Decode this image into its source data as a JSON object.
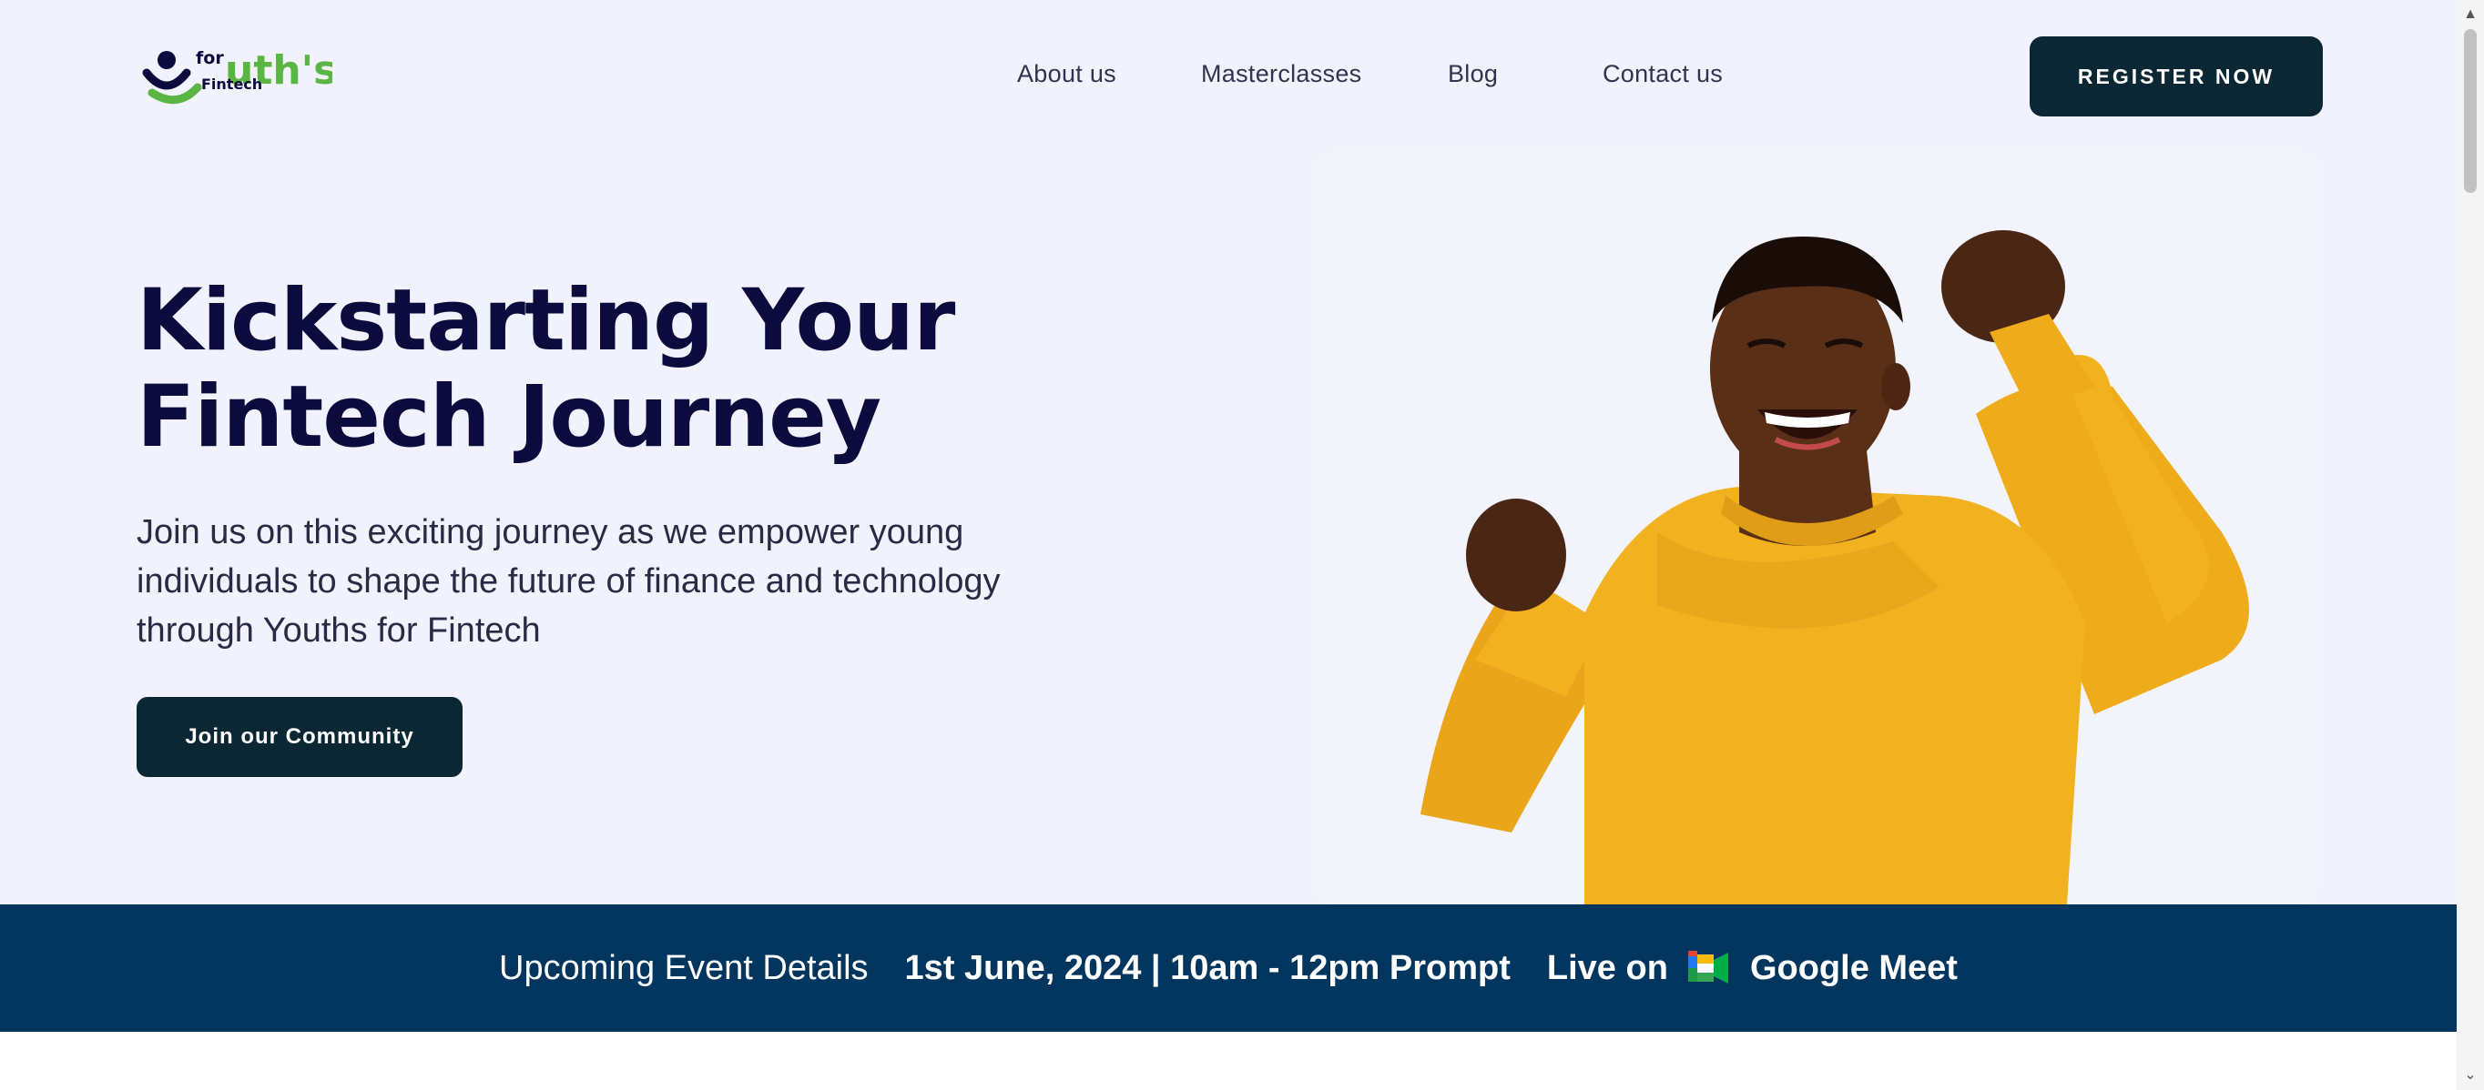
{
  "header": {
    "logo_text": "Youths for Fintech",
    "nav": [
      "About us",
      "Masterclasses",
      "Blog",
      "Contact us"
    ],
    "register_label": "REGISTER NOW"
  },
  "hero": {
    "headline_line1": "Kickstarting Your",
    "headline_line2": "Fintech Journey",
    "subtext": "Join us on this exciting journey as we empower young individuals to shape the future of finance and technology through Youths for Fintech",
    "cta_label": "Join our Community",
    "image_alt": "Smiling young man in a yellow sweater raising his fists in celebration"
  },
  "event": {
    "label": "Upcoming Event Details",
    "date_time": "1st June, 2024 | 10am - 12pm Prompt",
    "live_on": "Live on",
    "platform": "Google Meet"
  },
  "colors": {
    "hero_bg": "#f2f2fc",
    "primary_dark": "#0b2734",
    "headline": "#0b0b3d",
    "event_bar": "#03365f",
    "logo_green": "#5bb544",
    "sweater_yellow": "#f2b11e"
  },
  "icons": {
    "meet": "google-meet-icon",
    "scroll_up": "chevron-up-icon",
    "scroll_down": "chevron-down-icon"
  }
}
